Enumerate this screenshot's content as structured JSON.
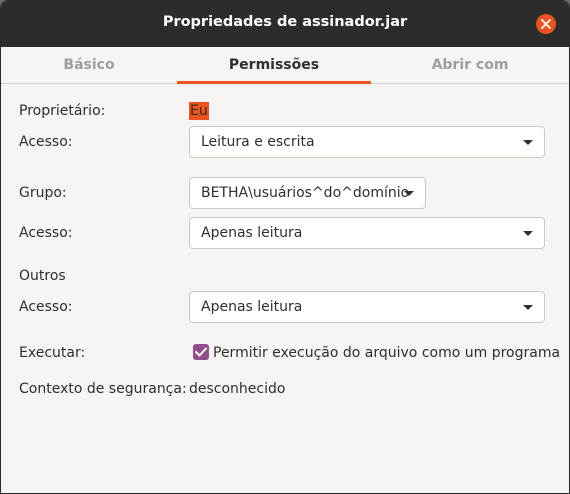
{
  "window": {
    "title": "Propriedades de assinador.jar"
  },
  "tabs": [
    {
      "label": "Básico",
      "active": false
    },
    {
      "label": "Permissões",
      "active": true
    },
    {
      "label": "Abrir com",
      "active": false
    }
  ],
  "permissions": {
    "owner_label": "Proprietário:",
    "owner_value": "Eu",
    "owner_access_label": "Acesso:",
    "owner_access_value": "Leitura e escrita",
    "group_label": "Grupo:",
    "group_value": "BETHA\\usuários^do^domínio",
    "group_access_label": "Acesso:",
    "group_access_value": "Apenas leitura",
    "others_label": "Outros",
    "others_access_label": "Acesso:",
    "others_access_value": "Apenas leitura",
    "execute_label": "Executar:",
    "execute_checkbox_label": "Permitir execução do arquivo como um programa",
    "execute_checked": true,
    "security_context_label": "Contexto de segurança:",
    "security_context_value": "desconhecido"
  },
  "colors": {
    "accent": "#e95420",
    "checkbox": "#924d8b",
    "titlebar": "#2c2c2c"
  }
}
